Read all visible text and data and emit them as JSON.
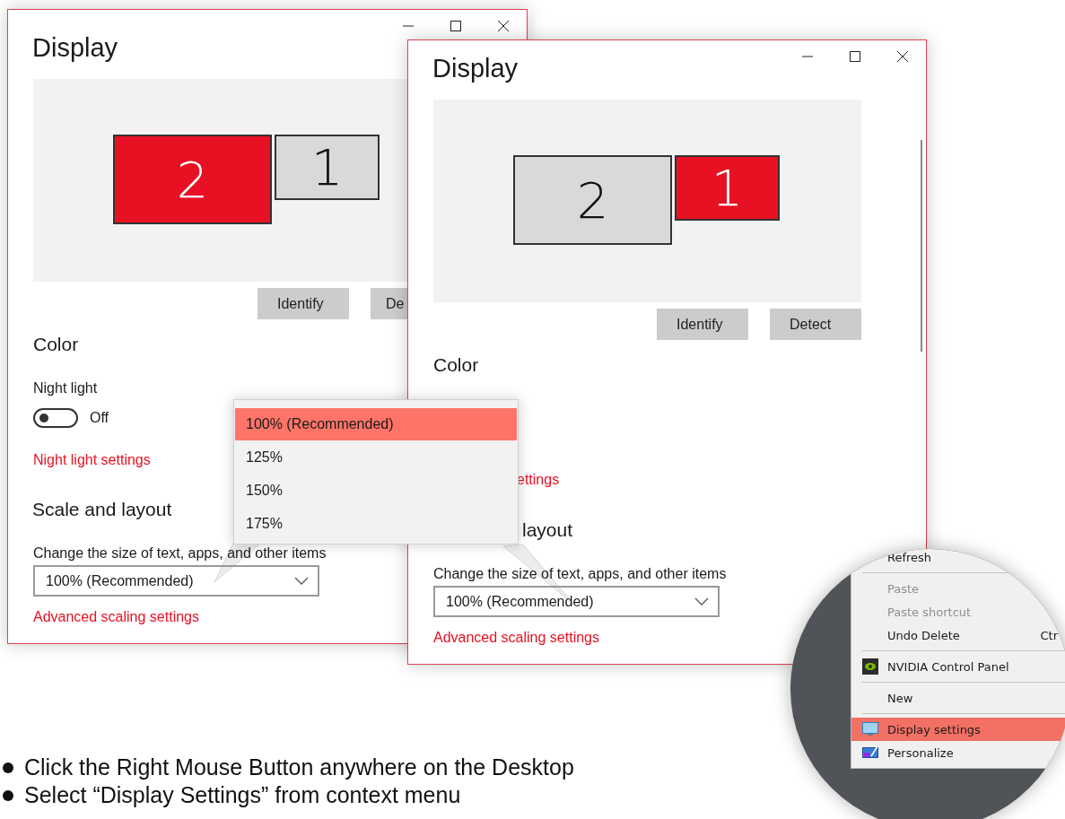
{
  "windows": [
    {
      "title": "Display",
      "monitors": [
        {
          "label": "2",
          "selected": true
        },
        {
          "label": "1",
          "selected": false
        }
      ],
      "buttons": [
        "Identify",
        "De"
      ],
      "color_heading": "Color",
      "night_light": {
        "label": "Night light",
        "on": false,
        "state": "Off"
      },
      "night_light_link": "Night light settings",
      "scale_heading": "Scale and layout",
      "scale_label": "Change the size of text, apps, and other items",
      "scale_value": "100% (Recommended)",
      "advanced_link": "Advanced scaling settings"
    },
    {
      "title": "Display",
      "monitors": [
        {
          "label": "2",
          "selected": false
        },
        {
          "label": "1",
          "selected": true
        }
      ],
      "buttons": [
        "Identify",
        "Detect"
      ],
      "color_heading": "Color",
      "night_light_link": "ettings",
      "scale_heading": "layout",
      "scale_label": "Change the size of text, apps, and other items",
      "scale_value": "100% (Recommended)",
      "advanced_link": "Advanced scaling settings"
    }
  ],
  "scale_dropdown": {
    "options": [
      {
        "label": "100% (Recommended)",
        "selected": true
      },
      {
        "label": "125%",
        "selected": false
      },
      {
        "label": "150%",
        "selected": false
      },
      {
        "label": "175%",
        "selected": false
      }
    ]
  },
  "context_menu": {
    "items": [
      {
        "kind": "text",
        "label": "Refresh",
        "disabled": false,
        "selected": false
      },
      {
        "kind": "separator"
      },
      {
        "kind": "text",
        "label": "Paste",
        "disabled": true,
        "selected": false
      },
      {
        "kind": "text",
        "label": "Paste shortcut",
        "disabled": true,
        "selected": false
      },
      {
        "kind": "text",
        "label": "Undo Delete",
        "shortcut": "Ctr",
        "disabled": false,
        "selected": false
      },
      {
        "kind": "separator"
      },
      {
        "kind": "app_link",
        "label": "NVIDIA Control Panel",
        "disabled": false,
        "selected": false
      },
      {
        "kind": "separator"
      },
      {
        "kind": "text",
        "label": "New",
        "disabled": false,
        "selected": false
      },
      {
        "kind": "separator"
      },
      {
        "kind": "display_link",
        "label": "Display settings",
        "disabled": false,
        "selected": true
      },
      {
        "kind": "theme_link",
        "label": "Personalize",
        "disabled": false,
        "selected": false
      }
    ]
  },
  "instructions": [
    "Click the Right Mouse Button anywhere on the Desktop",
    "Select “Display Settings” from context menu"
  ]
}
